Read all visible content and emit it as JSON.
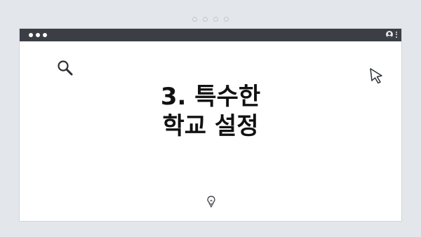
{
  "carousel": {
    "dot_count": 4
  },
  "window": {
    "titlebar": {
      "traffic_lights": 3,
      "right_icons": [
        "user-icon",
        "more-vertical-icon"
      ]
    },
    "heading": {
      "line1": "3. 특수한",
      "line2": "학교 설정"
    },
    "decorations": [
      "search-icon",
      "cursor-icon",
      "lightbulb-icon"
    ]
  },
  "colors": {
    "background": "#e3e6ea",
    "titlebar": "#3b3f45",
    "window": "#ffffff",
    "heading_text": "#111111",
    "icon_stroke": "#2b2f35"
  }
}
